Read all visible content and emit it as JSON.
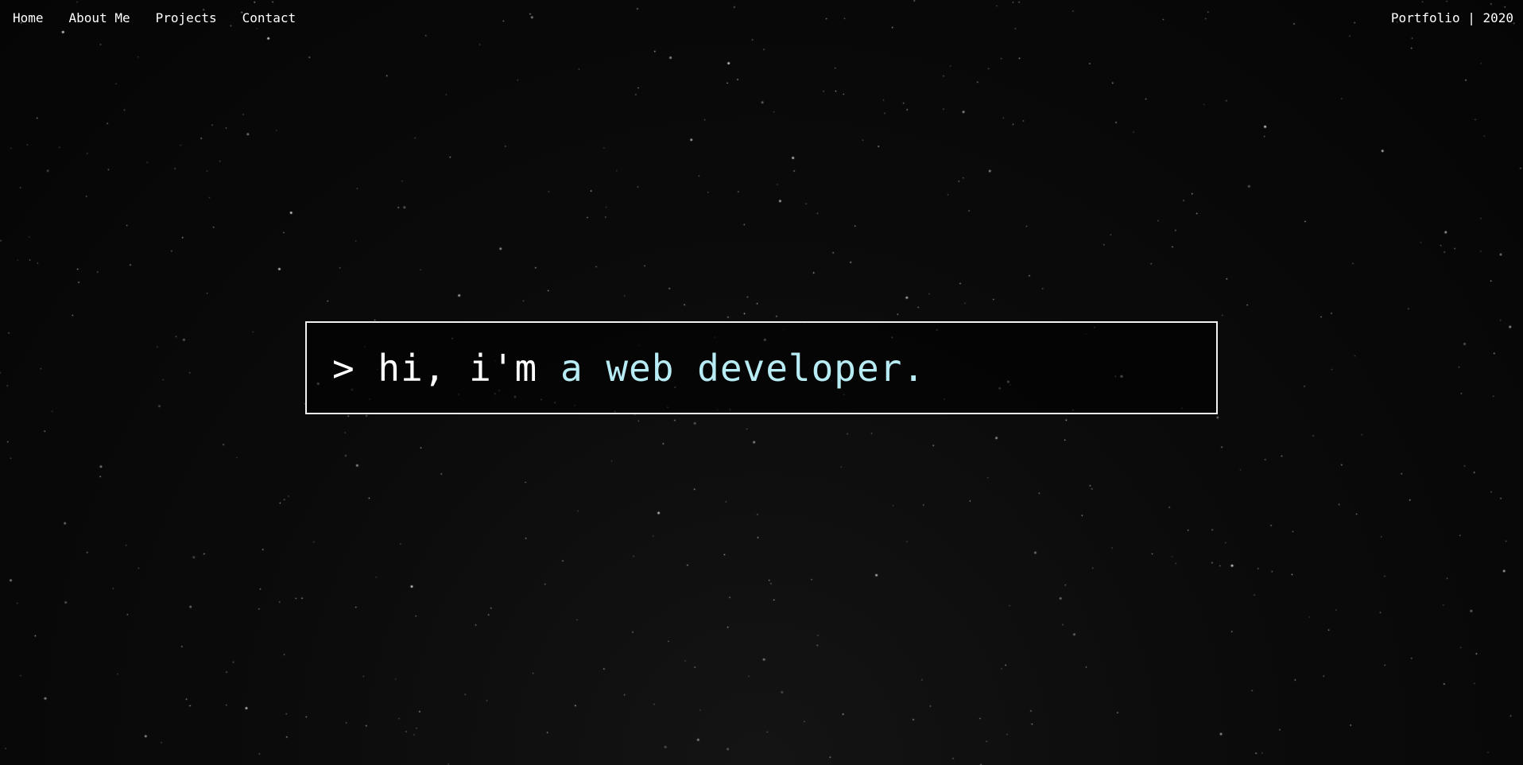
{
  "nav": {
    "items": [
      {
        "label": "Home"
      },
      {
        "label": "About Me"
      },
      {
        "label": "Projects"
      },
      {
        "label": "Contact"
      }
    ]
  },
  "brand": {
    "label": "Portfolio | 2020"
  },
  "hero": {
    "prompt": "> ",
    "greeting": "hi, i'm ",
    "role": "a web developer."
  },
  "colors": {
    "background": "#070707",
    "text": "#ffffff",
    "accent": "#b8ecf5",
    "border": "#f2f2f2"
  }
}
